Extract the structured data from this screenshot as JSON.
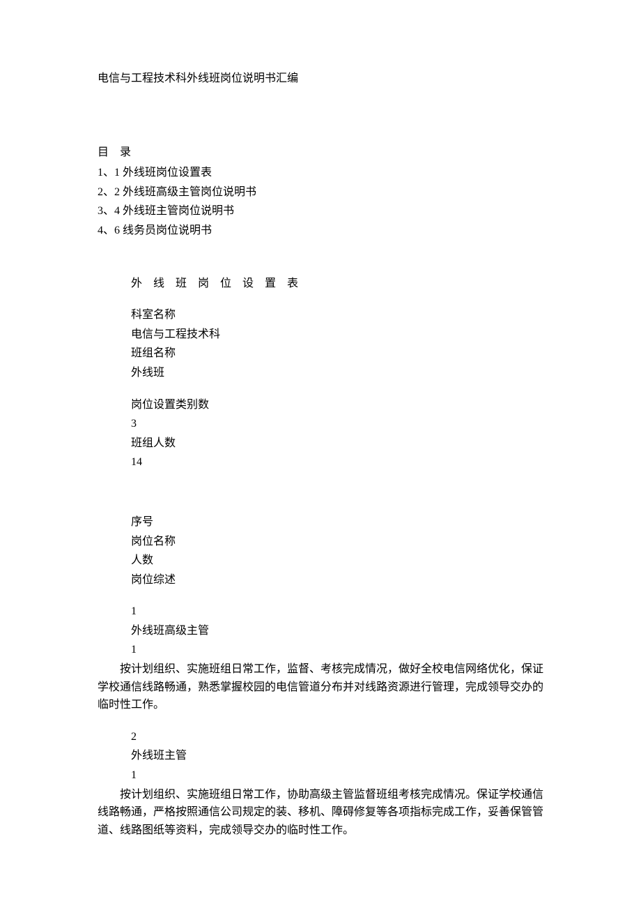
{
  "title": "电信与工程技术科外线班岗位说明书汇编",
  "toc": {
    "header": "目　录",
    "items": [
      "1、1 外线班岗位设置表",
      "2、2 外线班高级主管岗位说明书",
      "3、4 外线班主管岗位说明书",
      "4、6 线务员岗位说明书"
    ]
  },
  "section_title": "外 线 班 岗 位 设 置 表",
  "meta": {
    "dept_label": "科室名称",
    "dept_value": "电信与工程技术科",
    "team_label": "班组名称",
    "team_value": "外线班",
    "cat_label": "岗位设置类别数",
    "cat_value": "3",
    "count_label": "班组人数",
    "count_value": "14"
  },
  "headers": {
    "seq": "序号",
    "name": "岗位名称",
    "num": "人数",
    "summary": "岗位综述"
  },
  "positions": [
    {
      "seq": "1",
      "name": "外线班高级主管",
      "num": "1",
      "summary": "按计划组织、实施班组日常工作，监督、考核完成情况，做好全校电信网络优化，保证学校通信线路畅通，熟悉掌握校园的电信管道分布并对线路资源进行管理，完成领导交办的临时性工作。"
    },
    {
      "seq": "2",
      "name": "外线班主管",
      "num": "1",
      "summary": "按计划组织、实施班组日常工作，协助高级主管监督班组考核完成情况。保证学校通信线路畅通，严格按照通信公司规定的装、移机、障碍修复等各项指标完成工作，妥善保管管道、线路图纸等资料，完成领导交办的临时性工作。"
    }
  ]
}
